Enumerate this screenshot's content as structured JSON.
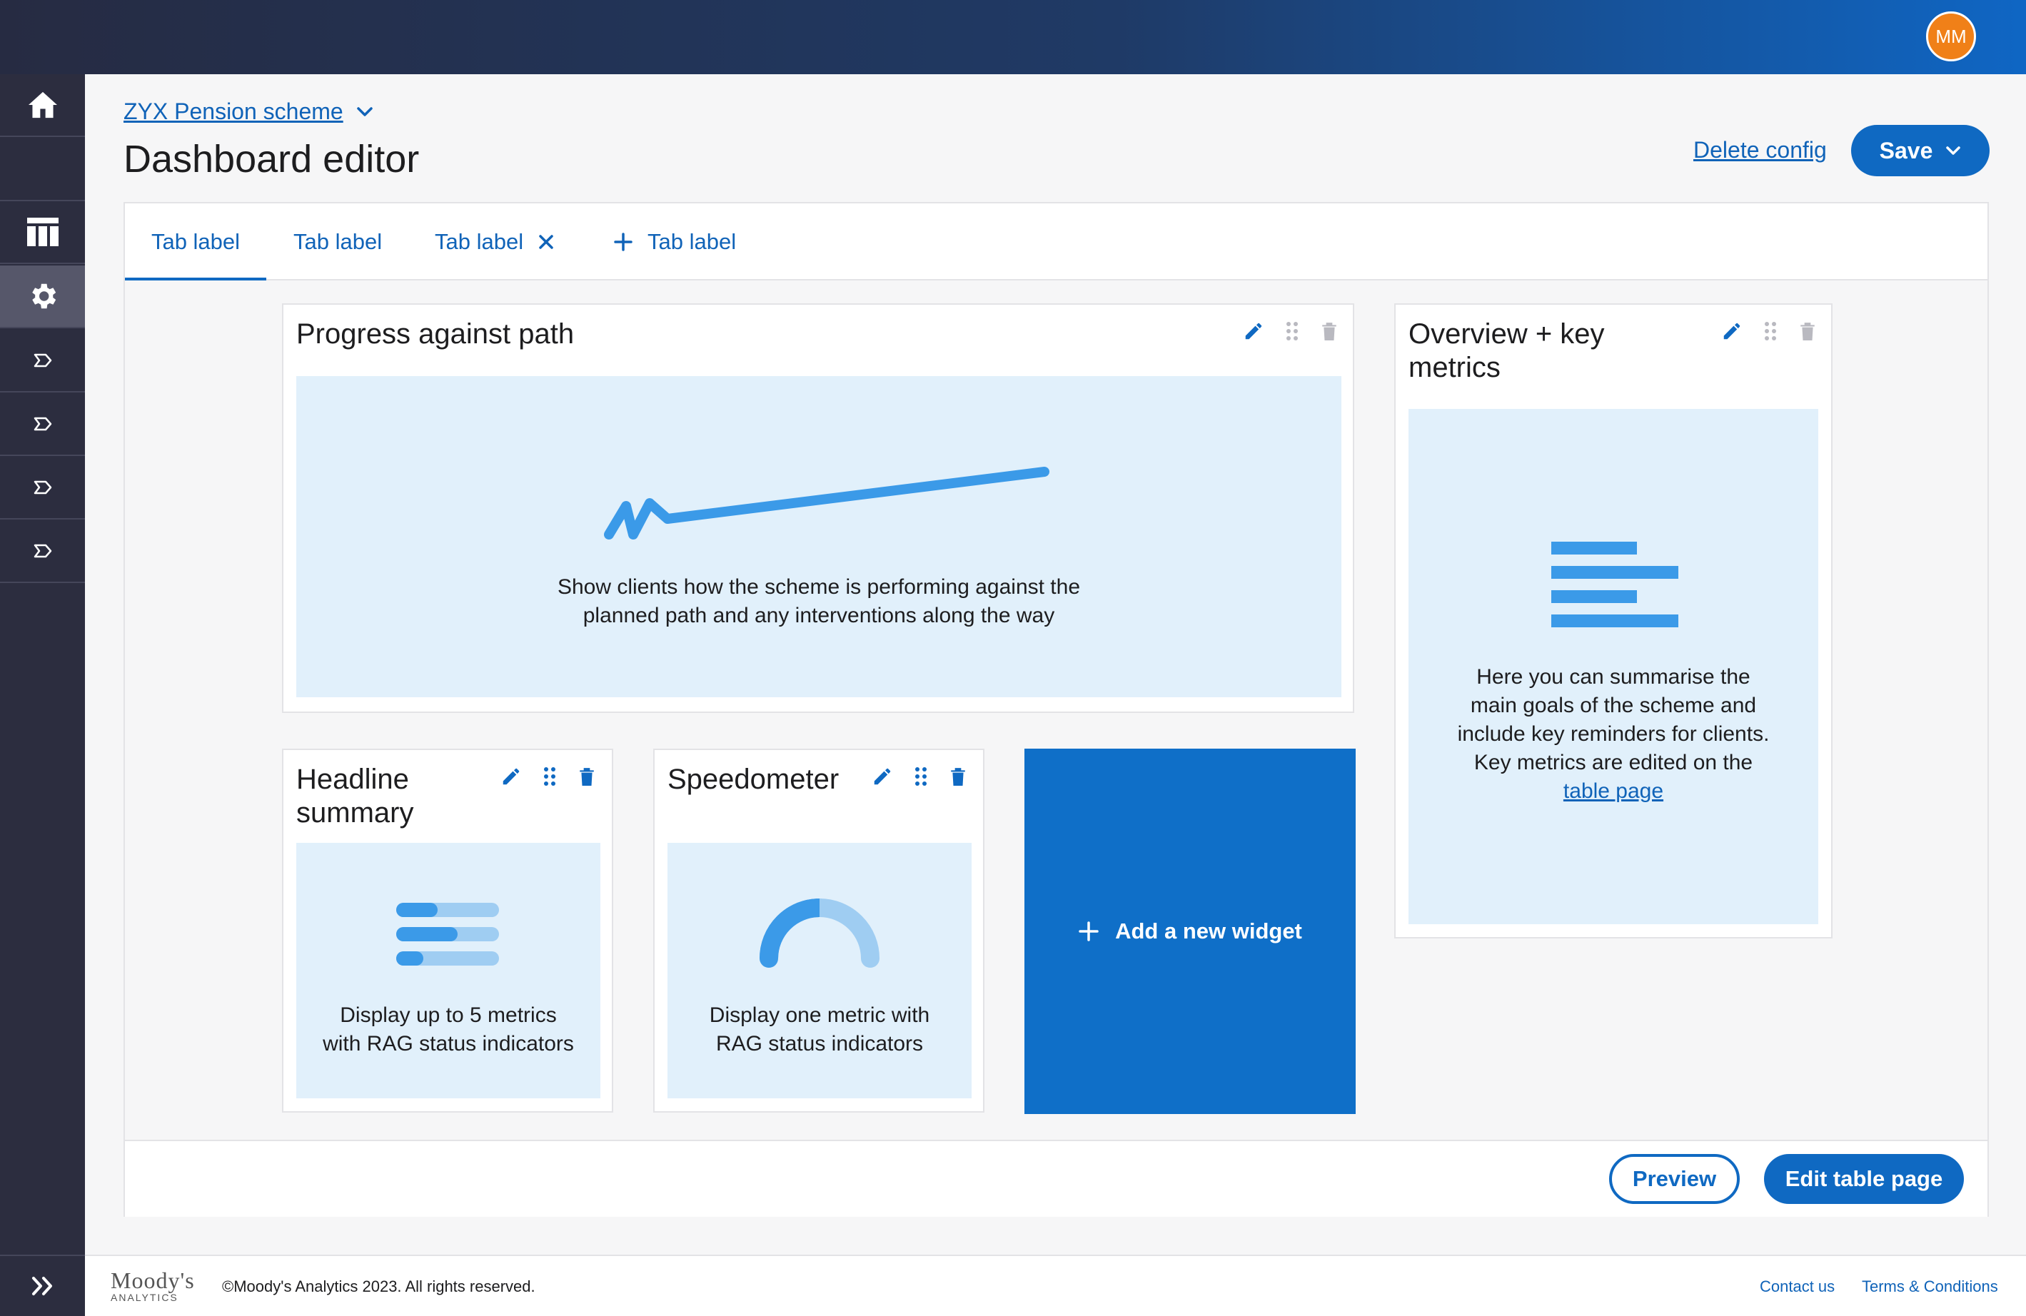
{
  "header": {
    "avatar_initials": "MM"
  },
  "sidebar": {
    "items": [
      {
        "name": "home-icon"
      },
      {
        "name": "table-icon"
      },
      {
        "name": "gear-icon",
        "active": true
      },
      {
        "name": "tag-icon"
      },
      {
        "name": "tag-icon"
      },
      {
        "name": "tag-icon"
      },
      {
        "name": "tag-icon"
      }
    ],
    "expand_icon": "double-chevron-right-icon"
  },
  "page": {
    "breadcrumb": "ZYX Pension scheme",
    "title": "Dashboard editor",
    "delete_label": "Delete config",
    "save_label": "Save"
  },
  "tabs": [
    {
      "label": "Tab label",
      "active": true
    },
    {
      "label": "Tab label"
    },
    {
      "label": "Tab label",
      "closable": true
    },
    {
      "label": "Tab label",
      "add": true
    }
  ],
  "widgets": {
    "progress": {
      "title": "Progress against path",
      "desc_line1": "Show clients how the scheme is performing against the",
      "desc_line2": "planned path and any interventions along the way"
    },
    "overview": {
      "title_line1": "Overview + key",
      "title_line2": "metrics",
      "desc_line1": "Here you can summarise the",
      "desc_line2": "main goals of the scheme and",
      "desc_line3": "include key reminders for clients.",
      "desc_line4": "Key metrics are edited on the",
      "link": "table page"
    },
    "headline": {
      "title_line1": "Headline",
      "title_line2": "summary",
      "desc_line1": "Display up to 5 metrics",
      "desc_line2": "with RAG status indicators"
    },
    "speedometer": {
      "title": "Speedometer",
      "desc_line1": "Display one metric with",
      "desc_line2": "RAG status indicators"
    },
    "add_label": "Add a new widget"
  },
  "actions": {
    "preview_label": "Preview",
    "edit_label": "Edit table page"
  },
  "footer": {
    "logo_main": "Moody's",
    "logo_sub": "ANALYTICS",
    "copyright": "©Moody's Analytics 2023. All rights reserved.",
    "contact": "Contact us",
    "terms": "Terms & Conditions"
  },
  "colors": {
    "primary": "#0f69c2",
    "light_blue": "#e1f0fb",
    "sidebar": "#2c2d3f",
    "avatar": "#f08018"
  }
}
